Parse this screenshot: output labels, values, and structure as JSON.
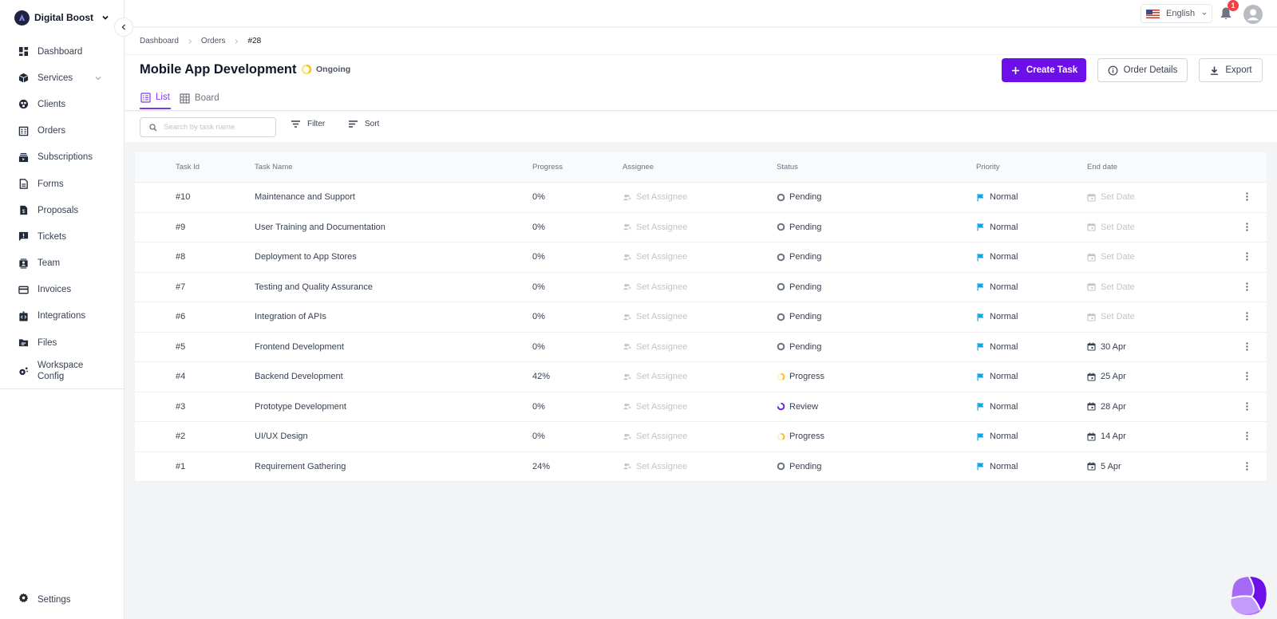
{
  "workspace": {
    "name": "Digital Boost"
  },
  "sidebar": {
    "items": [
      {
        "label": "Dashboard",
        "icon": "dashboard-icon"
      },
      {
        "label": "Services",
        "icon": "box-icon",
        "expandable": true
      },
      {
        "label": "Clients",
        "icon": "clients-icon"
      },
      {
        "label": "Orders",
        "icon": "orders-icon"
      },
      {
        "label": "Subscriptions",
        "icon": "subscriptions-icon"
      },
      {
        "label": "Forms",
        "icon": "forms-icon"
      },
      {
        "label": "Proposals",
        "icon": "proposals-icon"
      },
      {
        "label": "Tickets",
        "icon": "tickets-icon"
      },
      {
        "label": "Team",
        "icon": "team-icon"
      },
      {
        "label": "Invoices",
        "icon": "invoices-icon"
      },
      {
        "label": "Integrations",
        "icon": "integrations-icon"
      },
      {
        "label": "Files",
        "icon": "files-icon"
      },
      {
        "label": "Workspace Config",
        "icon": "workspace-config-icon"
      }
    ],
    "settings_label": "Settings"
  },
  "topbar": {
    "language": "English",
    "notifications_count": "1"
  },
  "breadcrumb": [
    "Dashboard",
    "Orders",
    "#28"
  ],
  "header": {
    "title": "Mobile App Development",
    "status": "Ongoing",
    "create_task_label": "Create Task",
    "order_details_label": "Order Details",
    "export_label": "Export",
    "tabs": [
      {
        "label": "List",
        "active": true
      },
      {
        "label": "Board",
        "active": false
      }
    ]
  },
  "toolbar": {
    "search_placeholder": "Search by task name",
    "search_value": "",
    "filter_label": "Filter",
    "sort_label": "Sort"
  },
  "colors": {
    "accent": "#6d0fe8",
    "pending": "#6b7280",
    "progress": "#fbbf24",
    "review": "#6d28d9",
    "priority_normal": "#0ea5e9"
  },
  "table": {
    "columns": [
      "Task Id",
      "Task Name",
      "Progress",
      "Assignee",
      "Status",
      "Priority",
      "End date"
    ],
    "rows": [
      {
        "id": "#10",
        "name": "Maintenance and Support",
        "progress": "0%",
        "assignee": "Set Assignee",
        "status": "Pending",
        "priority": "Normal",
        "end_date": "Set Date",
        "date_set": false
      },
      {
        "id": "#9",
        "name": "User Training and Documentation",
        "progress": "0%",
        "assignee": "Set Assignee",
        "status": "Pending",
        "priority": "Normal",
        "end_date": "Set Date",
        "date_set": false
      },
      {
        "id": "#8",
        "name": "Deployment to App Stores",
        "progress": "0%",
        "assignee": "Set Assignee",
        "status": "Pending",
        "priority": "Normal",
        "end_date": "Set Date",
        "date_set": false
      },
      {
        "id": "#7",
        "name": "Testing and Quality Assurance",
        "progress": "0%",
        "assignee": "Set Assignee",
        "status": "Pending",
        "priority": "Normal",
        "end_date": "Set Date",
        "date_set": false
      },
      {
        "id": "#6",
        "name": "Integration of APIs",
        "progress": "0%",
        "assignee": "Set Assignee",
        "status": "Pending",
        "priority": "Normal",
        "end_date": "Set Date",
        "date_set": false
      },
      {
        "id": "#5",
        "name": "Frontend Development",
        "progress": "0%",
        "assignee": "Set Assignee",
        "status": "Pending",
        "priority": "Normal",
        "end_date": "30 Apr",
        "date_set": true
      },
      {
        "id": "#4",
        "name": "Backend Development",
        "progress": "42%",
        "assignee": "Set Assignee",
        "status": "Progress",
        "priority": "Normal",
        "end_date": "25 Apr",
        "date_set": true
      },
      {
        "id": "#3",
        "name": "Prototype Development",
        "progress": "0%",
        "assignee": "Set Assignee",
        "status": "Review",
        "priority": "Normal",
        "end_date": "28 Apr",
        "date_set": true
      },
      {
        "id": "#2",
        "name": "UI/UX Design",
        "progress": "0%",
        "assignee": "Set Assignee",
        "status": "Progress",
        "priority": "Normal",
        "end_date": "14 Apr",
        "date_set": true
      },
      {
        "id": "#1",
        "name": "Requirement Gathering",
        "progress": "24%",
        "assignee": "Set Assignee",
        "status": "Pending",
        "priority": "Normal",
        "end_date": "5 Apr",
        "date_set": true
      }
    ]
  }
}
